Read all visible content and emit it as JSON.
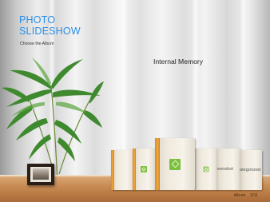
{
  "header": {
    "title_line1": "PHOTO",
    "title_line2": "SLIDESHOW",
    "subtitle": "Choose the Album"
  },
  "storage": {
    "label": "Internal Memory"
  },
  "albums": [
    {
      "label": "",
      "icon": "album-icon"
    },
    {
      "label": "",
      "icon": "album-icon"
    },
    {
      "label": "",
      "icon": "album-icon"
    },
    {
      "label": "",
      "icon": "album-icon"
    },
    {
      "label": "eenshot",
      "icon": "album-icon"
    },
    {
      "label": "ategorized",
      "icon": "album-icon"
    }
  ],
  "status": {
    "label": "Album",
    "page": "3/11"
  },
  "colors": {
    "accent": "#2b8fe8",
    "spine": "#f0a93f",
    "gem": "#7bbf3f"
  }
}
